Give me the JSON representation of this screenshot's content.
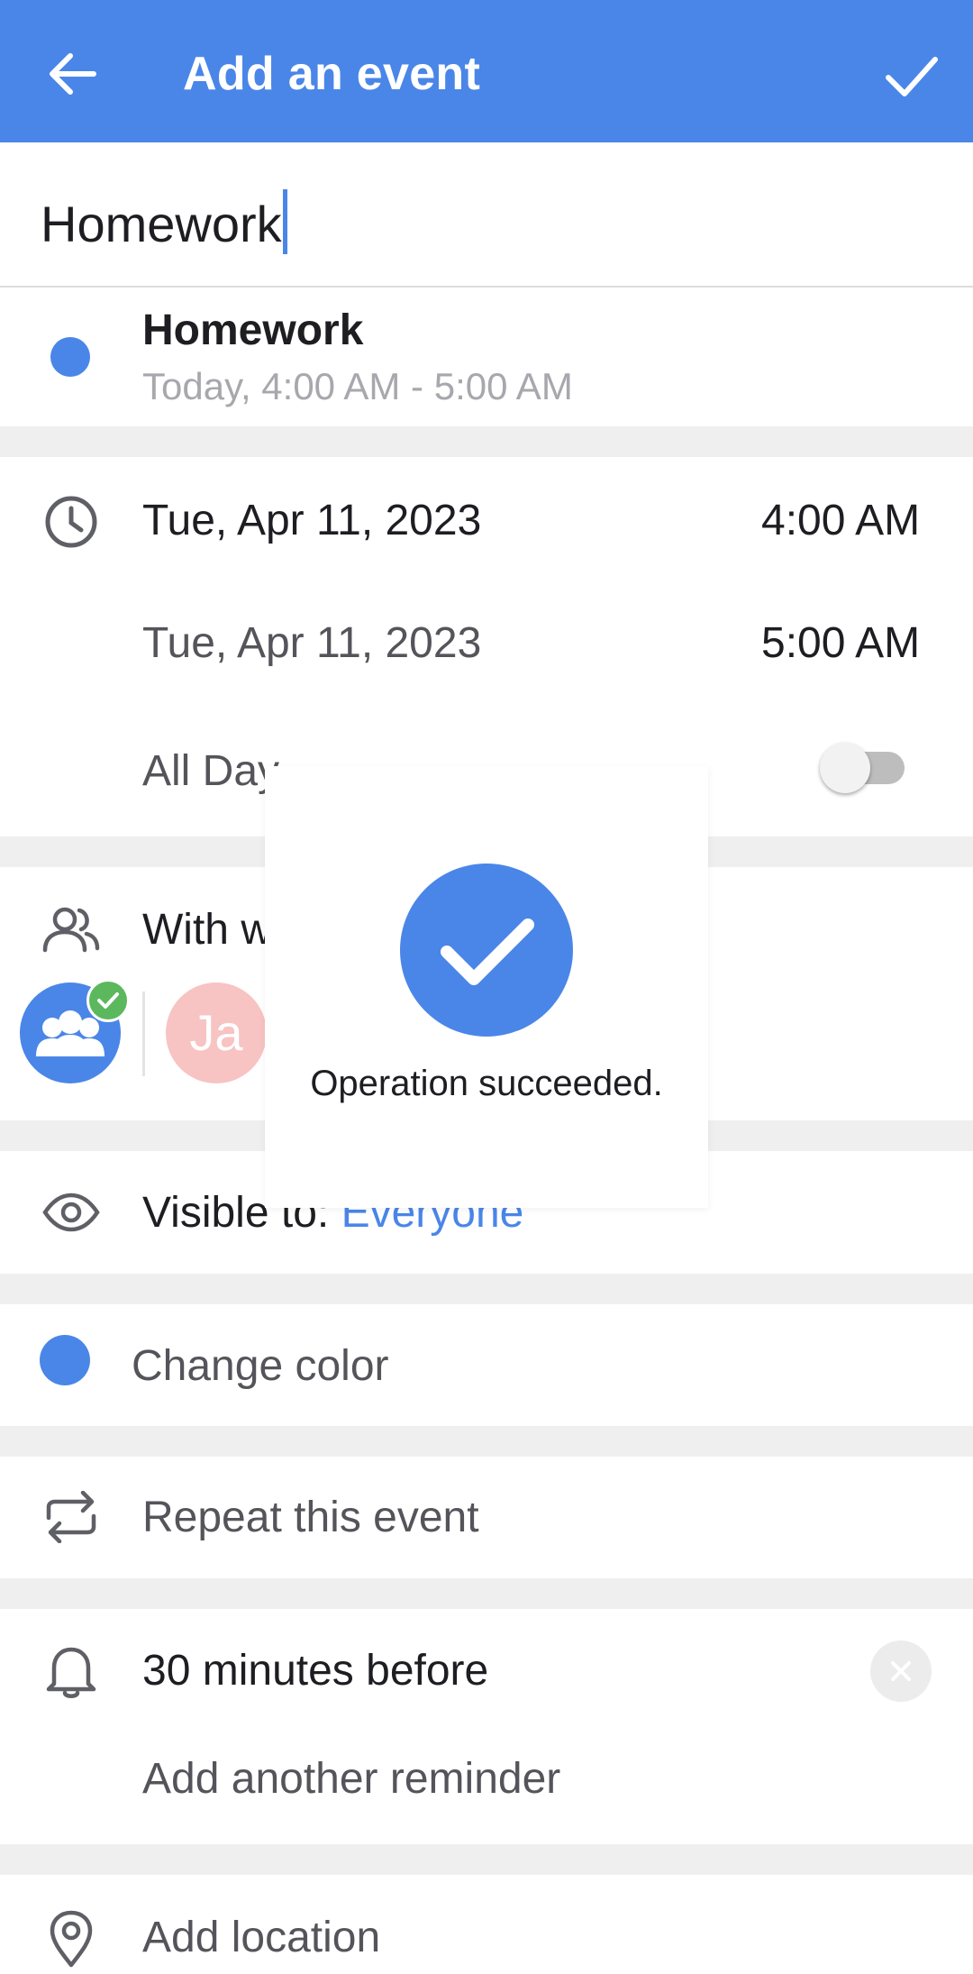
{
  "appbar": {
    "title": "Add an event",
    "back_icon": "arrow-left-icon",
    "done_icon": "check-icon",
    "color": "#4a86e8"
  },
  "title_input": {
    "value": "Homework"
  },
  "summary": {
    "name": "Homework",
    "time_range": "Today, 4:00 AM - 5:00 AM",
    "color": "#4a86e8"
  },
  "datetime": {
    "start_date": "Tue, Apr 11, 2023",
    "start_time": "4:00 AM",
    "end_date": "Tue, Apr 11, 2023",
    "end_time": "5:00 AM",
    "all_day_label": "All Day",
    "all_day_on": false
  },
  "participants": {
    "label": "With w",
    "person_initials": "Ja"
  },
  "visibility": {
    "prefix": "Visible to: ",
    "value": "Everyone"
  },
  "color": {
    "label": "Change color"
  },
  "repeat": {
    "label": "Repeat this event"
  },
  "reminder": {
    "label": "30 minutes before",
    "add_label": "Add another reminder"
  },
  "location": {
    "label": "Add location"
  },
  "toast": {
    "message": "Operation succeeded."
  }
}
